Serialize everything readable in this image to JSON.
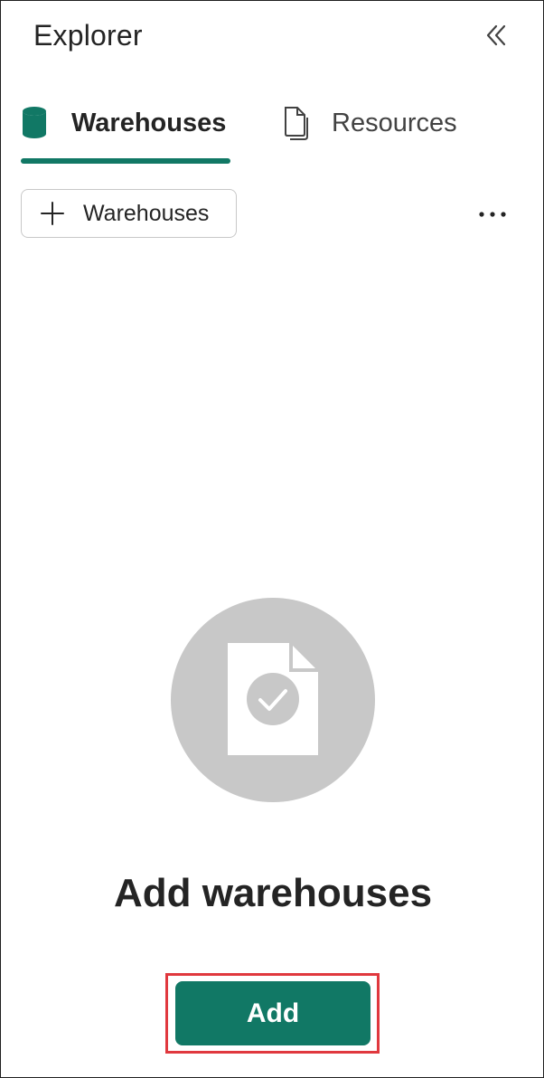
{
  "panel": {
    "title": "Explorer",
    "collapse_icon": "double-chevron-left-icon"
  },
  "tabs": [
    {
      "label": "Warehouses",
      "icon": "database-icon",
      "selected": true
    },
    {
      "label": "Resources",
      "icon": "documents-icon",
      "selected": false
    }
  ],
  "toolbar": {
    "add_label": "Warehouses",
    "add_icon": "plus-icon",
    "more_icon": "more-horizontal-icon"
  },
  "empty_state": {
    "illustration_icon": "document-check-icon",
    "heading": "Add warehouses",
    "button_label": "Add"
  },
  "colors": {
    "accent": "#117865",
    "highlight": "#e0383e",
    "illustration_bg": "#c8c8c8"
  }
}
